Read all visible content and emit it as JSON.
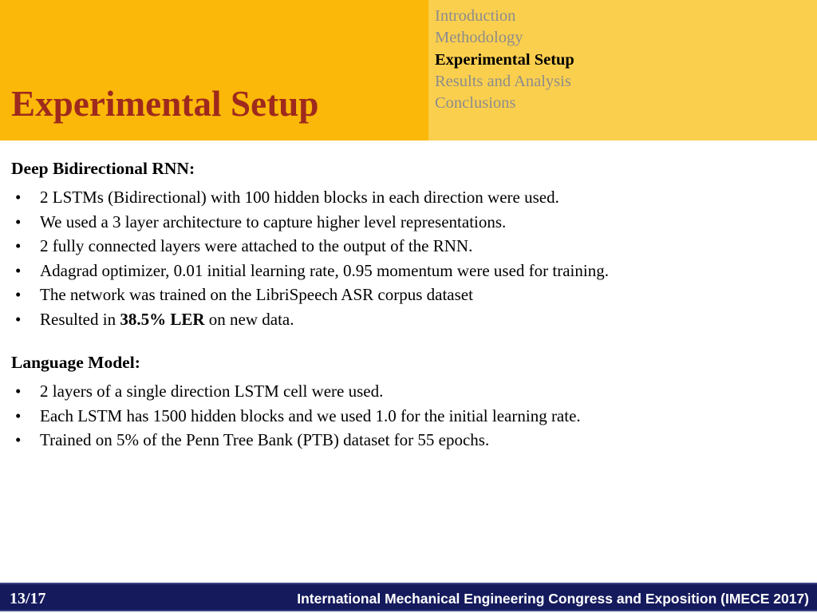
{
  "slide": {
    "title": "Experimental Setup",
    "title_color": "#9e2a1e",
    "header_left_color": "#fbb808",
    "header_right_color": "#facf4e",
    "footer_color": "#141a5c"
  },
  "section_nav": {
    "items": [
      {
        "label": "Introduction",
        "active": false
      },
      {
        "label": "Methodology",
        "active": false
      },
      {
        "label": "Experimental Setup",
        "active": true
      },
      {
        "label": "Results and Analysis",
        "active": false
      },
      {
        "label": "Conclusions",
        "active": false
      }
    ]
  },
  "content": {
    "groups": [
      {
        "heading": "Deep Bidirectional RNN:",
        "bullet_marker": "•",
        "bullets": [
          {
            "text": "2 LSTMs (Bidirectional) with 100 hidden blocks in each direction were used."
          },
          {
            "text": "We used a 3 layer architecture to capture higher level representations."
          },
          {
            "text": "2 fully connected layers were attached to the output of the RNN."
          },
          {
            "text": "Adagrad optimizer, 0.01 initial learning rate, 0.95 momentum were used for training."
          },
          {
            "text": "The network was trained on the LibriSpeech ASR corpus dataset"
          },
          {
            "prefix": "Resulted in ",
            "bold": "38.5% LER",
            "suffix": " on new data."
          }
        ]
      },
      {
        "heading": "Language Model:",
        "bullet_marker": "•",
        "bullets": [
          {
            "text": "2 layers of a single direction LSTM cell were used."
          },
          {
            "text": "Each LSTM has 1500 hidden blocks and we used 1.0 for the initial learning rate."
          },
          {
            "text": "Trained on 5% of the Penn Tree Bank (PTB) dataset for 55 epochs."
          }
        ]
      }
    ]
  },
  "footer": {
    "slide_number": "13/17",
    "conference": "International Mechanical Engineering Congress and Exposition (IMECE 2017)"
  }
}
